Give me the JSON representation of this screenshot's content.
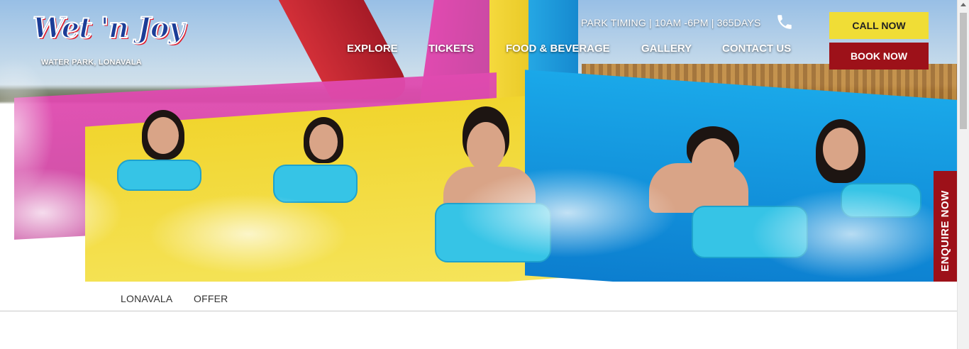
{
  "logo": {
    "brand": "Wet 'n Joy",
    "tagline": "WATER PARK, LONAVALA"
  },
  "header": {
    "timing": "PARK TIMING | 10AM -6PM | 365DAYS",
    "phone_icon": "phone-icon"
  },
  "nav": [
    {
      "label": "EXPLORE"
    },
    {
      "label": "TICKETS"
    },
    {
      "label": "FOOD & BEVERAGE"
    },
    {
      "label": "GALLERY"
    },
    {
      "label": "CONTACT US"
    }
  ],
  "buttons": {
    "call": "CALL NOW",
    "book": "BOOK NOW"
  },
  "side_tab": {
    "label": "ENQUIRE NOW"
  },
  "subnav": [
    {
      "label": "LONAVALA"
    },
    {
      "label": "OFFER"
    }
  ],
  "colors": {
    "call_bg": "#f0dd36",
    "book_bg": "#9d1119",
    "enquire_bg": "#9d1119",
    "logo_blue": "#1c3d97",
    "logo_red": "#e01b2b"
  }
}
